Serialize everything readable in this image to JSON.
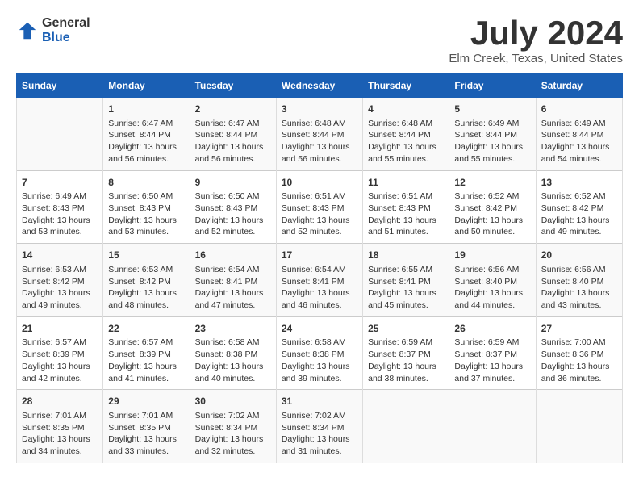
{
  "header": {
    "logo_general": "General",
    "logo_blue": "Blue",
    "month_title": "July 2024",
    "location": "Elm Creek, Texas, United States"
  },
  "days_of_week": [
    "Sunday",
    "Monday",
    "Tuesday",
    "Wednesday",
    "Thursday",
    "Friday",
    "Saturday"
  ],
  "weeks": [
    [
      {
        "day": "",
        "info": ""
      },
      {
        "day": "1",
        "info": "Sunrise: 6:47 AM\nSunset: 8:44 PM\nDaylight: 13 hours\nand 56 minutes."
      },
      {
        "day": "2",
        "info": "Sunrise: 6:47 AM\nSunset: 8:44 PM\nDaylight: 13 hours\nand 56 minutes."
      },
      {
        "day": "3",
        "info": "Sunrise: 6:48 AM\nSunset: 8:44 PM\nDaylight: 13 hours\nand 56 minutes."
      },
      {
        "day": "4",
        "info": "Sunrise: 6:48 AM\nSunset: 8:44 PM\nDaylight: 13 hours\nand 55 minutes."
      },
      {
        "day": "5",
        "info": "Sunrise: 6:49 AM\nSunset: 8:44 PM\nDaylight: 13 hours\nand 55 minutes."
      },
      {
        "day": "6",
        "info": "Sunrise: 6:49 AM\nSunset: 8:44 PM\nDaylight: 13 hours\nand 54 minutes."
      }
    ],
    [
      {
        "day": "7",
        "info": ""
      },
      {
        "day": "8",
        "info": "Sunrise: 6:50 AM\nSunset: 8:43 PM\nDaylight: 13 hours\nand 53 minutes."
      },
      {
        "day": "9",
        "info": "Sunrise: 6:50 AM\nSunset: 8:43 PM\nDaylight: 13 hours\nand 52 minutes."
      },
      {
        "day": "10",
        "info": "Sunrise: 6:51 AM\nSunset: 8:43 PM\nDaylight: 13 hours\nand 52 minutes."
      },
      {
        "day": "11",
        "info": "Sunrise: 6:51 AM\nSunset: 8:43 PM\nDaylight: 13 hours\nand 51 minutes."
      },
      {
        "day": "12",
        "info": "Sunrise: 6:52 AM\nSunset: 8:42 PM\nDaylight: 13 hours\nand 50 minutes."
      },
      {
        "day": "13",
        "info": "Sunrise: 6:52 AM\nSunset: 8:42 PM\nDaylight: 13 hours\nand 49 minutes."
      }
    ],
    [
      {
        "day": "14",
        "info": ""
      },
      {
        "day": "15",
        "info": "Sunrise: 6:53 AM\nSunset: 8:42 PM\nDaylight: 13 hours\nand 48 minutes."
      },
      {
        "day": "16",
        "info": "Sunrise: 6:54 AM\nSunset: 8:41 PM\nDaylight: 13 hours\nand 47 minutes."
      },
      {
        "day": "17",
        "info": "Sunrise: 6:54 AM\nSunset: 8:41 PM\nDaylight: 13 hours\nand 46 minutes."
      },
      {
        "day": "18",
        "info": "Sunrise: 6:55 AM\nSunset: 8:41 PM\nDaylight: 13 hours\nand 45 minutes."
      },
      {
        "day": "19",
        "info": "Sunrise: 6:56 AM\nSunset: 8:40 PM\nDaylight: 13 hours\nand 44 minutes."
      },
      {
        "day": "20",
        "info": "Sunrise: 6:56 AM\nSunset: 8:40 PM\nDaylight: 13 hours\nand 43 minutes."
      }
    ],
    [
      {
        "day": "21",
        "info": ""
      },
      {
        "day": "22",
        "info": "Sunrise: 6:57 AM\nSunset: 8:39 PM\nDaylight: 13 hours\nand 41 minutes."
      },
      {
        "day": "23",
        "info": "Sunrise: 6:58 AM\nSunset: 8:38 PM\nDaylight: 13 hours\nand 40 minutes."
      },
      {
        "day": "24",
        "info": "Sunrise: 6:58 AM\nSunset: 8:38 PM\nDaylight: 13 hours\nand 39 minutes."
      },
      {
        "day": "25",
        "info": "Sunrise: 6:59 AM\nSunset: 8:37 PM\nDaylight: 13 hours\nand 38 minutes."
      },
      {
        "day": "26",
        "info": "Sunrise: 6:59 AM\nSunset: 8:37 PM\nDaylight: 13 hours\nand 37 minutes."
      },
      {
        "day": "27",
        "info": "Sunrise: 7:00 AM\nSunset: 8:36 PM\nDaylight: 13 hours\nand 36 minutes."
      }
    ],
    [
      {
        "day": "28",
        "info": "Sunrise: 7:01 AM\nSunset: 8:35 PM\nDaylight: 13 hours\nand 34 minutes."
      },
      {
        "day": "29",
        "info": "Sunrise: 7:01 AM\nSunset: 8:35 PM\nDaylight: 13 hours\nand 33 minutes."
      },
      {
        "day": "30",
        "info": "Sunrise: 7:02 AM\nSunset: 8:34 PM\nDaylight: 13 hours\nand 32 minutes."
      },
      {
        "day": "31",
        "info": "Sunrise: 7:02 AM\nSunset: 8:34 PM\nDaylight: 13 hours\nand 31 minutes."
      },
      {
        "day": "",
        "info": ""
      },
      {
        "day": "",
        "info": ""
      },
      {
        "day": "",
        "info": ""
      }
    ]
  ],
  "week1_sunday_info": "Sunrise: 6:49 AM\nSunset: 8:43 PM\nDaylight: 13 hours\nand 53 minutes.",
  "week3_sunday_info": "Sunrise: 6:53 AM\nSunset: 8:42 PM\nDaylight: 13 hours\nand 49 minutes.",
  "week4_sunday_info": "Sunrise: 6:57 AM\nSunset: 8:39 PM\nDaylight: 13 hours\nand 42 minutes."
}
